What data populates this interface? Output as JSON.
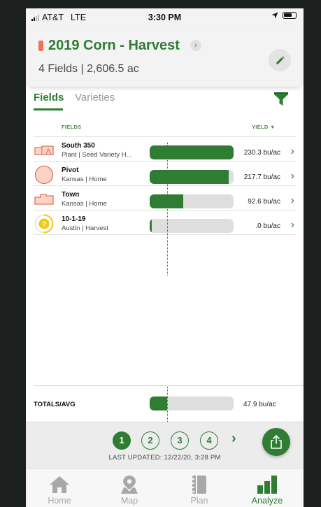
{
  "status_bar": {
    "carrier": "AT&T",
    "network": "LTE",
    "time": "3:30 PM"
  },
  "header": {
    "title": "2019 Corn - Harvest",
    "subtitle": "4 Fields | 2,606.5 ac",
    "accent_color": "#2e7d32",
    "season_color": "#f0725a"
  },
  "tabs": [
    {
      "label": "Fields",
      "active": true
    },
    {
      "label": "Varieties",
      "active": false
    }
  ],
  "table": {
    "col_fields": "FIELDS",
    "col_yield": "YIELD ▼",
    "rows": [
      {
        "name": "South 350",
        "sub": "Plant | Seed Variety H...",
        "value": "230.3 bu/ac",
        "yield": 230.3,
        "icon": "field-shape-icon"
      },
      {
        "name": "Pivot",
        "sub": "Kansas | Home",
        "value": "217.7 bu/ac",
        "yield": 217.7,
        "icon": "pivot-circle-icon"
      },
      {
        "name": "Town",
        "sub": "Kansas | Home",
        "value": "92.6 bu/ac",
        "yield": 92.6,
        "icon": "town-field-icon"
      },
      {
        "name": "10-1-19",
        "sub": "Austin | Harvest",
        "value": ".0 bu/ac",
        "yield": 0.0,
        "icon": "unknown-field-icon"
      }
    ],
    "bar_max": 230.3
  },
  "totals": {
    "label": "TOTALS/AVG",
    "value": "47.9 bu/ac",
    "yield": 47.9
  },
  "pager": {
    "pages": [
      "1",
      "2",
      "3",
      "4"
    ],
    "active_page": "1",
    "next": "›",
    "last_updated": "LAST UPDATED: 12/22/20, 3:28 PM"
  },
  "bottom_nav": [
    {
      "label": "Home",
      "icon": "home-icon",
      "active": false
    },
    {
      "label": "Map",
      "icon": "map-pin-icon",
      "active": false
    },
    {
      "label": "Plan",
      "icon": "notebook-icon",
      "active": false
    },
    {
      "label": "Analyze",
      "icon": "bar-chart-icon",
      "active": true
    }
  ]
}
